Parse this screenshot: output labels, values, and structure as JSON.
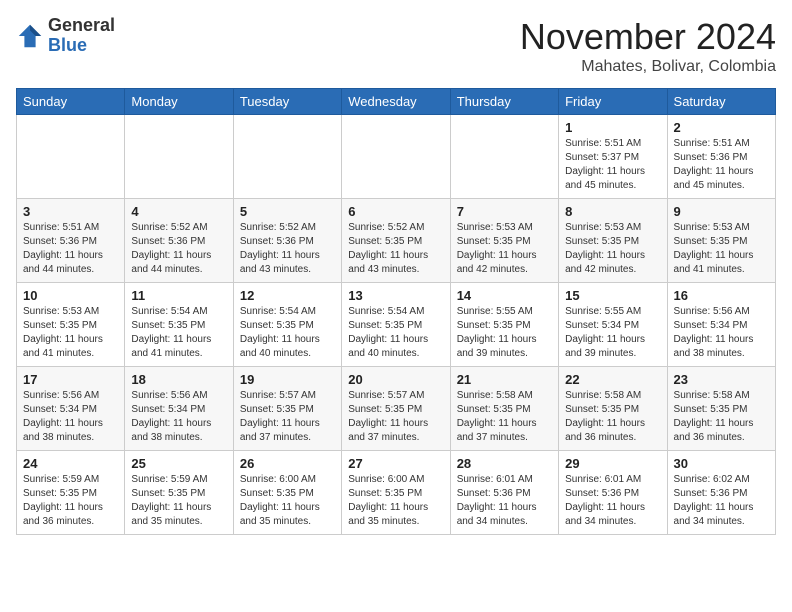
{
  "header": {
    "logo_line1": "General",
    "logo_line2": "Blue",
    "month_year": "November 2024",
    "location": "Mahates, Bolivar, Colombia"
  },
  "days_of_week": [
    "Sunday",
    "Monday",
    "Tuesday",
    "Wednesday",
    "Thursday",
    "Friday",
    "Saturday"
  ],
  "weeks": [
    [
      {
        "day": "",
        "info": ""
      },
      {
        "day": "",
        "info": ""
      },
      {
        "day": "",
        "info": ""
      },
      {
        "day": "",
        "info": ""
      },
      {
        "day": "",
        "info": ""
      },
      {
        "day": "1",
        "info": "Sunrise: 5:51 AM\nSunset: 5:37 PM\nDaylight: 11 hours and 45 minutes."
      },
      {
        "day": "2",
        "info": "Sunrise: 5:51 AM\nSunset: 5:36 PM\nDaylight: 11 hours and 45 minutes."
      }
    ],
    [
      {
        "day": "3",
        "info": "Sunrise: 5:51 AM\nSunset: 5:36 PM\nDaylight: 11 hours and 44 minutes."
      },
      {
        "day": "4",
        "info": "Sunrise: 5:52 AM\nSunset: 5:36 PM\nDaylight: 11 hours and 44 minutes."
      },
      {
        "day": "5",
        "info": "Sunrise: 5:52 AM\nSunset: 5:36 PM\nDaylight: 11 hours and 43 minutes."
      },
      {
        "day": "6",
        "info": "Sunrise: 5:52 AM\nSunset: 5:35 PM\nDaylight: 11 hours and 43 minutes."
      },
      {
        "day": "7",
        "info": "Sunrise: 5:53 AM\nSunset: 5:35 PM\nDaylight: 11 hours and 42 minutes."
      },
      {
        "day": "8",
        "info": "Sunrise: 5:53 AM\nSunset: 5:35 PM\nDaylight: 11 hours and 42 minutes."
      },
      {
        "day": "9",
        "info": "Sunrise: 5:53 AM\nSunset: 5:35 PM\nDaylight: 11 hours and 41 minutes."
      }
    ],
    [
      {
        "day": "10",
        "info": "Sunrise: 5:53 AM\nSunset: 5:35 PM\nDaylight: 11 hours and 41 minutes."
      },
      {
        "day": "11",
        "info": "Sunrise: 5:54 AM\nSunset: 5:35 PM\nDaylight: 11 hours and 41 minutes."
      },
      {
        "day": "12",
        "info": "Sunrise: 5:54 AM\nSunset: 5:35 PM\nDaylight: 11 hours and 40 minutes."
      },
      {
        "day": "13",
        "info": "Sunrise: 5:54 AM\nSunset: 5:35 PM\nDaylight: 11 hours and 40 minutes."
      },
      {
        "day": "14",
        "info": "Sunrise: 5:55 AM\nSunset: 5:35 PM\nDaylight: 11 hours and 39 minutes."
      },
      {
        "day": "15",
        "info": "Sunrise: 5:55 AM\nSunset: 5:34 PM\nDaylight: 11 hours and 39 minutes."
      },
      {
        "day": "16",
        "info": "Sunrise: 5:56 AM\nSunset: 5:34 PM\nDaylight: 11 hours and 38 minutes."
      }
    ],
    [
      {
        "day": "17",
        "info": "Sunrise: 5:56 AM\nSunset: 5:34 PM\nDaylight: 11 hours and 38 minutes."
      },
      {
        "day": "18",
        "info": "Sunrise: 5:56 AM\nSunset: 5:34 PM\nDaylight: 11 hours and 38 minutes."
      },
      {
        "day": "19",
        "info": "Sunrise: 5:57 AM\nSunset: 5:35 PM\nDaylight: 11 hours and 37 minutes."
      },
      {
        "day": "20",
        "info": "Sunrise: 5:57 AM\nSunset: 5:35 PM\nDaylight: 11 hours and 37 minutes."
      },
      {
        "day": "21",
        "info": "Sunrise: 5:58 AM\nSunset: 5:35 PM\nDaylight: 11 hours and 37 minutes."
      },
      {
        "day": "22",
        "info": "Sunrise: 5:58 AM\nSunset: 5:35 PM\nDaylight: 11 hours and 36 minutes."
      },
      {
        "day": "23",
        "info": "Sunrise: 5:58 AM\nSunset: 5:35 PM\nDaylight: 11 hours and 36 minutes."
      }
    ],
    [
      {
        "day": "24",
        "info": "Sunrise: 5:59 AM\nSunset: 5:35 PM\nDaylight: 11 hours and 36 minutes."
      },
      {
        "day": "25",
        "info": "Sunrise: 5:59 AM\nSunset: 5:35 PM\nDaylight: 11 hours and 35 minutes."
      },
      {
        "day": "26",
        "info": "Sunrise: 6:00 AM\nSunset: 5:35 PM\nDaylight: 11 hours and 35 minutes."
      },
      {
        "day": "27",
        "info": "Sunrise: 6:00 AM\nSunset: 5:35 PM\nDaylight: 11 hours and 35 minutes."
      },
      {
        "day": "28",
        "info": "Sunrise: 6:01 AM\nSunset: 5:36 PM\nDaylight: 11 hours and 34 minutes."
      },
      {
        "day": "29",
        "info": "Sunrise: 6:01 AM\nSunset: 5:36 PM\nDaylight: 11 hours and 34 minutes."
      },
      {
        "day": "30",
        "info": "Sunrise: 6:02 AM\nSunset: 5:36 PM\nDaylight: 11 hours and 34 minutes."
      }
    ]
  ]
}
